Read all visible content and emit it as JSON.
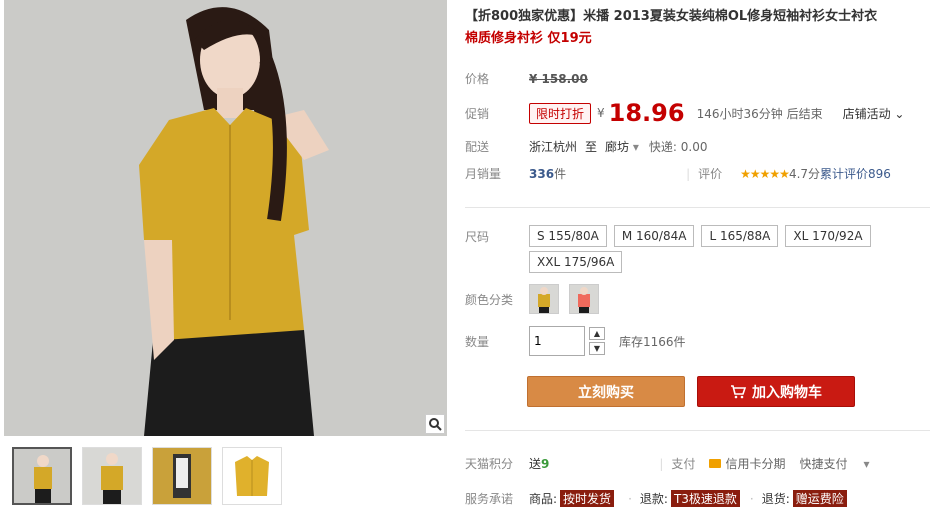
{
  "product": {
    "title_line1": "【折800独家优惠】米播 2013夏装女装纯棉OL修身短袖衬衫女士衬衣",
    "title_line2": "棉质修身衬衫 仅19元"
  },
  "price": {
    "label": "价格",
    "original": "¥ 158.00"
  },
  "promo": {
    "label": "促销",
    "tag": "限时打折",
    "currency": "¥",
    "price": "18.96",
    "countdown": "146小时36分钟 后结束",
    "store_activity": "店铺活动"
  },
  "shipping": {
    "label": "配送",
    "from": "浙江杭州",
    "to_word": "至",
    "to": "廊坊",
    "express": "快递: 0.00"
  },
  "sales": {
    "label": "月销量",
    "count": "336",
    "unit": "件",
    "rating_label": "评价",
    "stars": "★★★★★",
    "rating": "4.7分",
    "reviews": "累计评价896"
  },
  "sizes": {
    "label": "尺码",
    "options": [
      "S 155/80A",
      "M 160/84A",
      "L 165/88A",
      "XL 170/92A",
      "XXL 175/96A"
    ]
  },
  "colors": {
    "label": "颜色分类",
    "options": [
      "yellow",
      "coral"
    ]
  },
  "quantity": {
    "label": "数量",
    "value": "1",
    "stock": "库存1166件"
  },
  "buttons": {
    "buy_now": "立刻购买",
    "add_to_cart": "加入购物车"
  },
  "points": {
    "label": "天猫积分",
    "value_prefix": "送",
    "value": "9",
    "pay_label": "支付",
    "credit": "信用卡分期",
    "quick_pay": "快捷支付"
  },
  "service": {
    "label": "服务承诺",
    "goods": "商品:",
    "goods_tag": "按时发货",
    "refund": "退款:",
    "refund_tag": "T3极速退款",
    "return": "退货:",
    "return_tag": "赠运费险"
  },
  "colors_theme": {
    "accent": "#c40000",
    "buy_now": "#d88a45",
    "add_cart": "#c91a12"
  }
}
